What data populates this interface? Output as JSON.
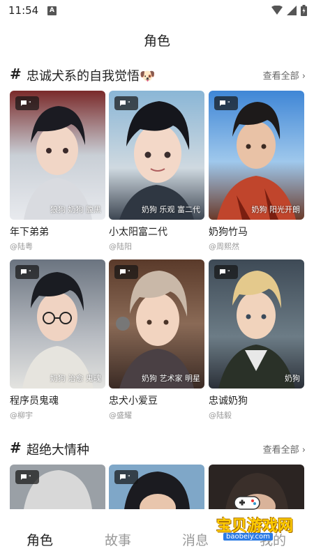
{
  "status_bar": {
    "time": "11:54",
    "notification_letter": "A"
  },
  "page_title": "角色",
  "sections": [
    {
      "title": "忠诚犬系的自我觉悟🐶",
      "more": "查看全部 ›",
      "cards": [
        {
          "tags": "狼狗 奶狗 腹黑",
          "name": "年下弟弟",
          "author": "@陆粤"
        },
        {
          "tags": "奶狗 乐观 富二代",
          "name": "小太阳富二代",
          "author": "@陆阳"
        },
        {
          "tags": "奶狗 阳光开朗",
          "name": "奶狗竹马",
          "author": "@周熙然"
        },
        {
          "tags": "奶狗 治愈 鬼魂",
          "name": "程序员鬼魂",
          "author": "@柳宇"
        },
        {
          "tags": "奶狗 艺术家 明星",
          "name": "忠犬小爱豆",
          "author": "@盛耀"
        },
        {
          "tags": "奶狗",
          "name": "忠诚奶狗",
          "author": "@陆毅"
        }
      ]
    },
    {
      "title": "超绝大情种",
      "more": "查看全部 ›"
    }
  ],
  "tabs": [
    "角色",
    "故事",
    "消息",
    "我的"
  ],
  "active_tab": "角色",
  "watermark": {
    "text": "宝贝游戏网",
    "url": "baobeiy.com"
  },
  "colors": {
    "accent_hash": "#ff4d7a",
    "badge_bg": "#141414"
  }
}
